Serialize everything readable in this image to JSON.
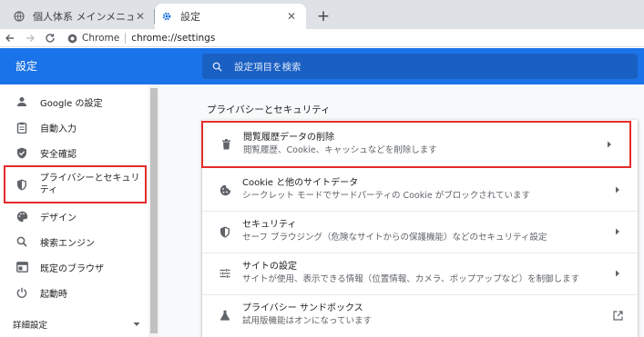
{
  "tabs": [
    {
      "title": "個人体系 メインメニュー",
      "active": false
    },
    {
      "title": "設定",
      "active": true
    }
  ],
  "omnibox": {
    "chip": "Chrome",
    "url": "chrome://settings"
  },
  "header": {
    "title": "設定",
    "search_placeholder": "設定項目を検索"
  },
  "sidebar": {
    "items": [
      {
        "label": "Google の設定",
        "icon": "person-icon"
      },
      {
        "label": "自動入力",
        "icon": "clipboard-icon"
      },
      {
        "label": "安全確認",
        "icon": "shield-check-icon"
      },
      {
        "label": "プライバシーとセキュリティ",
        "icon": "shield-icon",
        "active": true
      },
      {
        "label": "デザイン",
        "icon": "palette-icon"
      },
      {
        "label": "検索エンジン",
        "icon": "search-icon"
      },
      {
        "label": "既定のブラウザ",
        "icon": "browser-icon"
      },
      {
        "label": "起動時",
        "icon": "power-icon"
      }
    ],
    "advanced_label": "詳細設定"
  },
  "main": {
    "section_title": "プライバシーとセキュリティ",
    "rows": [
      {
        "title": "閲覧履歴データの削除",
        "subtitle": "閲覧履歴、Cookie、キャッシュなどを削除します",
        "icon": "trash-icon",
        "action": "arrow-right-icon"
      },
      {
        "title": "Cookie と他のサイトデータ",
        "subtitle": "シークレット モードでサードパーティの Cookie がブロックされています",
        "icon": "cookie-icon",
        "action": "arrow-right-icon"
      },
      {
        "title": "セキュリティ",
        "subtitle": "セーフ ブラウジング（危険なサイトからの保護機能）などのセキュリティ設定",
        "icon": "security-shield-icon",
        "action": "arrow-right-icon"
      },
      {
        "title": "サイトの設定",
        "subtitle": "サイトが使用、表示できる情報（位置情報、カメラ、ポップアップなど）を制御します",
        "icon": "tune-icon",
        "action": "arrow-right-icon"
      },
      {
        "title": "プライバシー サンドボックス",
        "subtitle": "試用版機能はオンになっています",
        "icon": "flask-icon",
        "action": "open-external-icon"
      }
    ]
  },
  "colors": {
    "accent": "#1a73e8",
    "highlight": "#e32b2b"
  }
}
